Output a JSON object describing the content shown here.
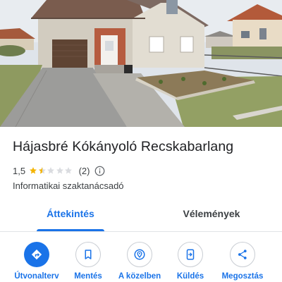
{
  "place": {
    "name": "Hájasbré Kókányoló Recskabarlang",
    "rating": "1,5",
    "rating_value": 1.5,
    "rating_max": 5,
    "review_count": "(2)",
    "category": "Informatikai szaktanácsadó"
  },
  "tabs": [
    {
      "label": "Áttekintés",
      "active": true
    },
    {
      "label": "Vélemények",
      "active": false
    }
  ],
  "actions": [
    {
      "label": "Útvonalterv",
      "icon": "directions-icon",
      "primary": true
    },
    {
      "label": "Mentés",
      "icon": "bookmark-icon",
      "primary": false
    },
    {
      "label": "A közelben",
      "icon": "nearby-icon",
      "primary": false
    },
    {
      "label": "Küldés",
      "icon": "send-to-phone-icon",
      "primary": false
    },
    {
      "label": "Megosztás",
      "icon": "share-icon",
      "primary": false
    }
  ],
  "colors": {
    "accent": "#1a73e8",
    "star": "#f4b400",
    "star_empty": "#dadce0",
    "text": "#202124",
    "secondary_text": "#3c4043"
  }
}
